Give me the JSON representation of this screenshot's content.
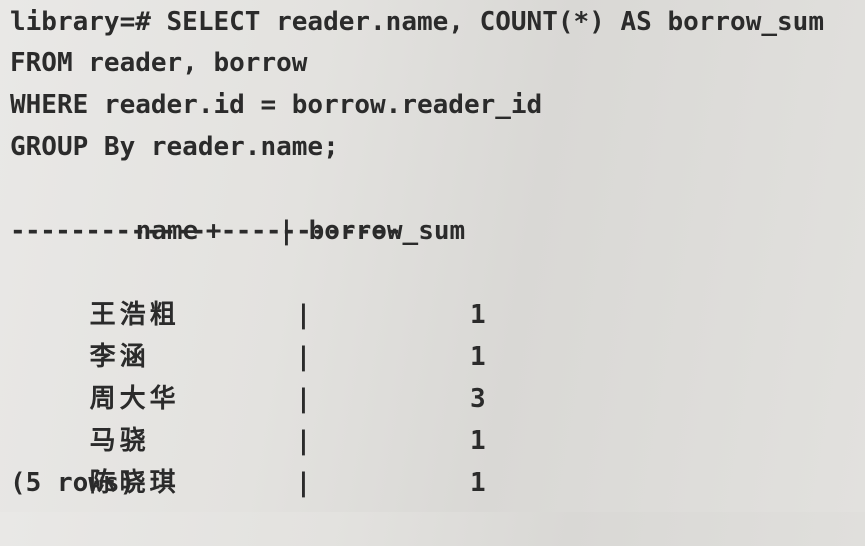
{
  "query": {
    "line1": "library=# SELECT reader.name, COUNT(*) AS borrow_sum",
    "line2": "FROM reader, borrow",
    "line3": "WHERE reader.id = borrow.reader_id",
    "line4": "GROUP By reader.name;"
  },
  "result": {
    "columns": [
      "name",
      "borrow_sum"
    ],
    "separator": "|",
    "divider": "-------------+------------",
    "rows": [
      {
        "name": "王浩粗",
        "borrow_sum": "1"
      },
      {
        "name": "李涵",
        "borrow_sum": "1"
      },
      {
        "name": "周大华",
        "borrow_sum": "3"
      },
      {
        "name": "马骁",
        "borrow_sum": "1"
      },
      {
        "name": "陈晓琪",
        "borrow_sum": "1"
      }
    ],
    "footer": "(5 rows)"
  }
}
